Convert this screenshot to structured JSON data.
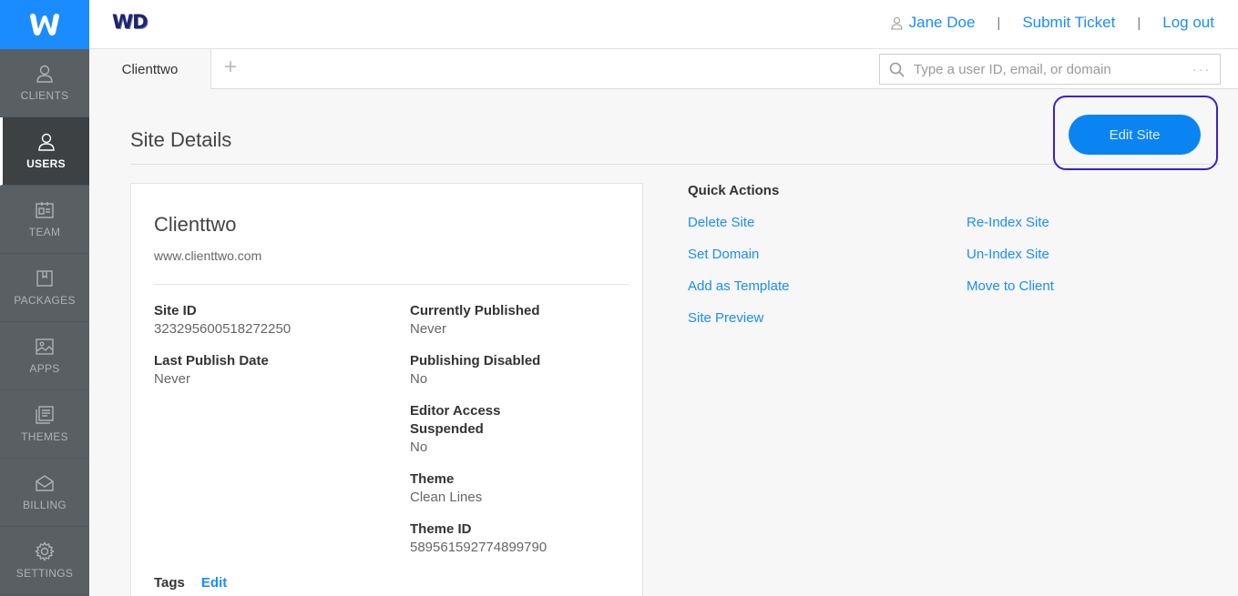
{
  "sidebar": {
    "items": [
      {
        "label": "CLIENTS",
        "icon": "person-icon",
        "active": false
      },
      {
        "label": "USERS",
        "icon": "user-icon",
        "active": true
      },
      {
        "label": "TEAM",
        "icon": "id-card-icon",
        "active": false
      },
      {
        "label": "PACKAGES",
        "icon": "package-icon",
        "active": false
      },
      {
        "label": "APPS",
        "icon": "image-icon",
        "active": false
      },
      {
        "label": "THEMES",
        "icon": "themes-icon",
        "active": false
      },
      {
        "label": "BILLING",
        "icon": "billing-icon",
        "active": false
      },
      {
        "label": "SETTINGS",
        "icon": "gear-icon",
        "active": false
      }
    ]
  },
  "header": {
    "logo_text": "WD",
    "user_name": "Jane Doe",
    "submit_ticket": "Submit Ticket",
    "logout": "Log out",
    "separator": "|"
  },
  "tabs": {
    "active_tab": "Clienttwo",
    "add_symbol": "+"
  },
  "search": {
    "placeholder": "Type a user ID, email, or domain",
    "more": "···"
  },
  "page": {
    "title": "Site Details",
    "edit_button": "Edit Site"
  },
  "site": {
    "name": "Clienttwo",
    "url": "www.clienttwo.com",
    "site_id_label": "Site ID",
    "site_id": "323295600518272250",
    "last_publish_label": "Last Publish Date",
    "last_publish": "Never",
    "currently_published_label": "Currently Published",
    "currently_published": "Never",
    "publishing_disabled_label": "Publishing Disabled",
    "publishing_disabled": "No",
    "editor_access_label": "Editor Access Suspended",
    "editor_access": "No",
    "theme_label": "Theme",
    "theme": "Clean Lines",
    "theme_id_label": "Theme ID",
    "theme_id": "589561592774899790",
    "tags_label": "Tags",
    "tags_edit": "Edit"
  },
  "quick_actions": {
    "title": "Quick Actions",
    "left": [
      "Delete Site",
      "Set Domain",
      "Add as Template",
      "Site Preview"
    ],
    "right": [
      "Re-Index Site",
      "Un-Index Site",
      "Move to Client"
    ]
  },
  "colors": {
    "brand_blue": "#1a8cff",
    "sidebar_bg": "#5a5f63",
    "highlight": "#3d1fcf"
  }
}
